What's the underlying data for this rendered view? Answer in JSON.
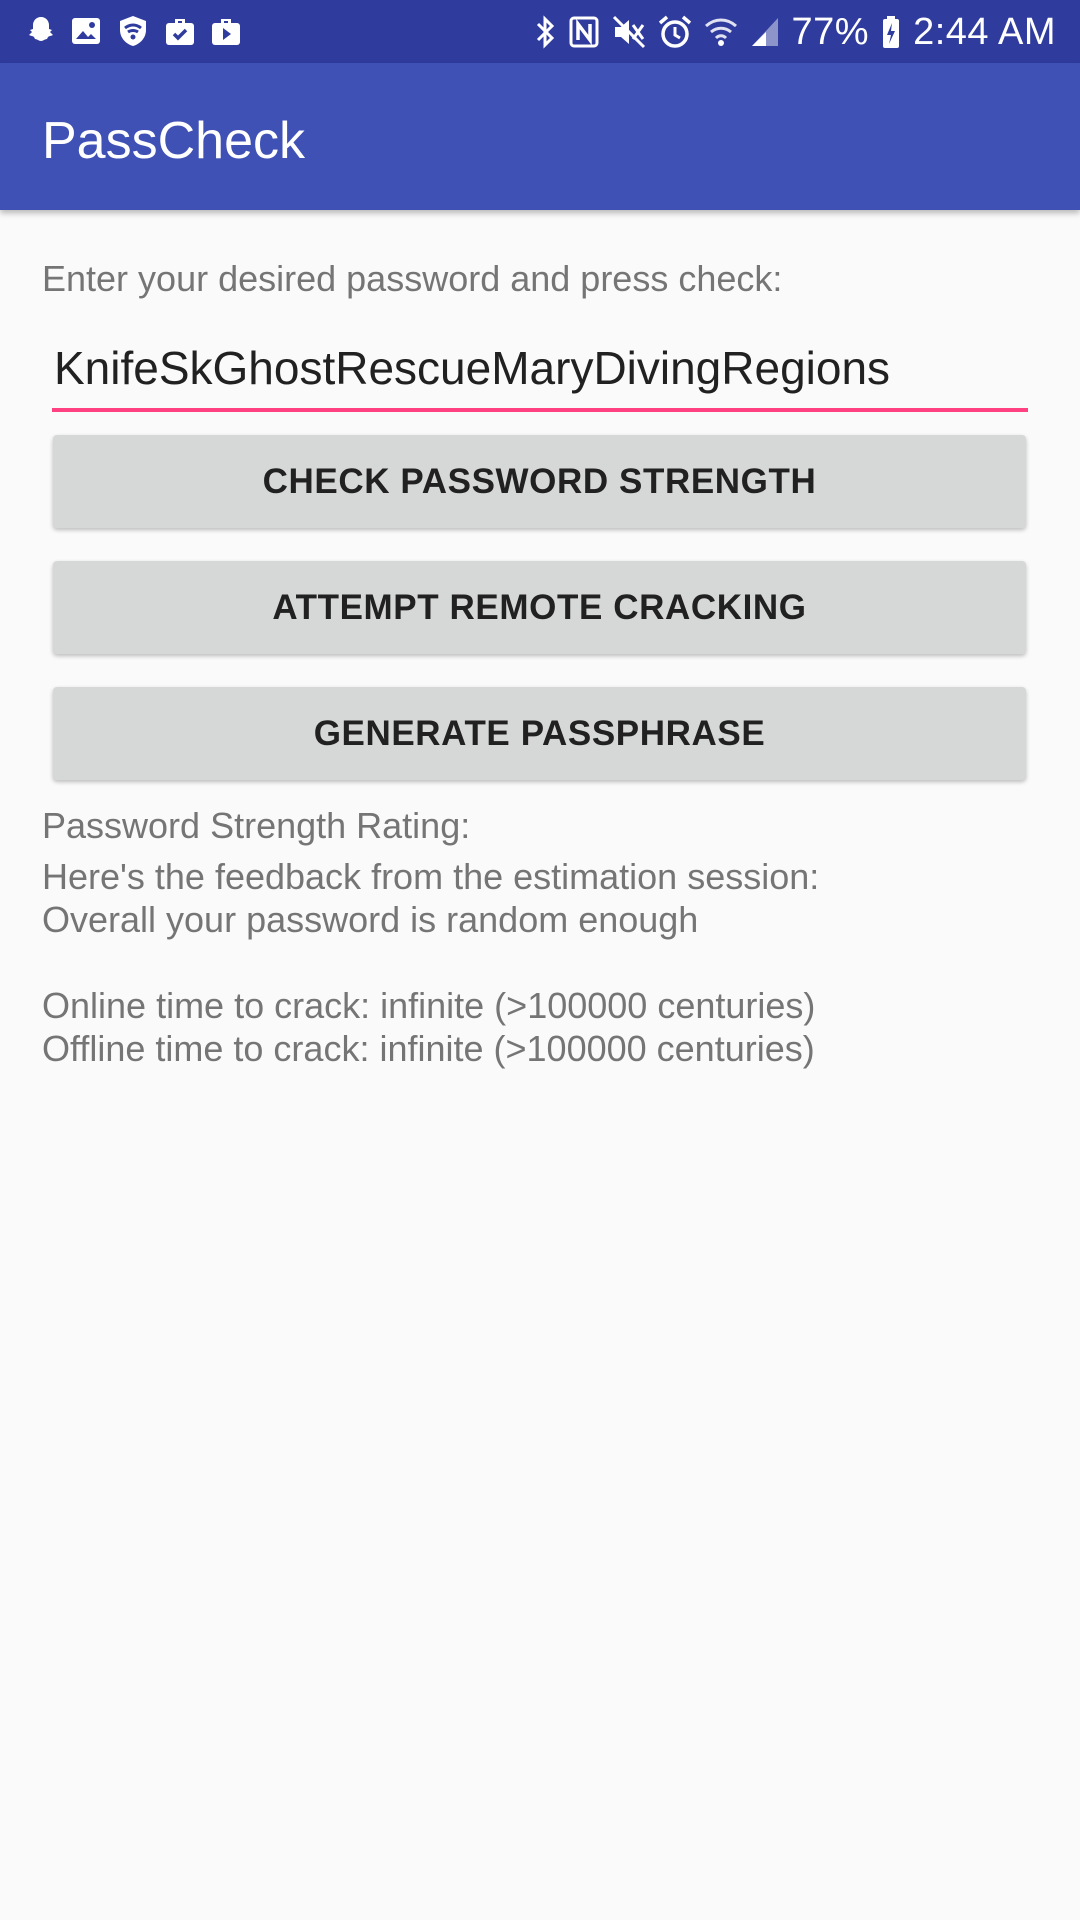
{
  "status_bar": {
    "left_icons": [
      "snapchat-icon",
      "image-icon",
      "shield-wifi-icon",
      "briefcase-check-icon",
      "briefcase-play-icon"
    ],
    "right_icons": [
      "bluetooth-icon",
      "nfc-icon",
      "mute-icon",
      "alarm-icon",
      "wifi-icon",
      "signal-icon"
    ],
    "battery": "77%",
    "time": "2:44 AM"
  },
  "app_bar": {
    "title": "PassCheck"
  },
  "form": {
    "prompt": "Enter your desired password and press check:",
    "password_value": "KnifeSkGhostRescueMaryDivingRegions",
    "accent_color": "#ff4081"
  },
  "buttons": {
    "check": "CHECK PASSWORD STRENGTH",
    "crack": "ATTEMPT REMOTE CRACKING",
    "generate": "GENERATE PASSPHRASE"
  },
  "results": {
    "rating_label": "Password Strength Rating:",
    "feedback_line": "Here's the feedback from the estimation session:",
    "overall": "Overall your password is random enough",
    "online": "Online time to crack: infinite (>100000 centuries)",
    "offline": "Offline time to crack: infinite (>100000 centuries)"
  },
  "colors": {
    "status_bar": "#2f3c9e",
    "app_bar": "#3f51b5",
    "button": "#d6d7d7",
    "background": "#fafafa"
  }
}
